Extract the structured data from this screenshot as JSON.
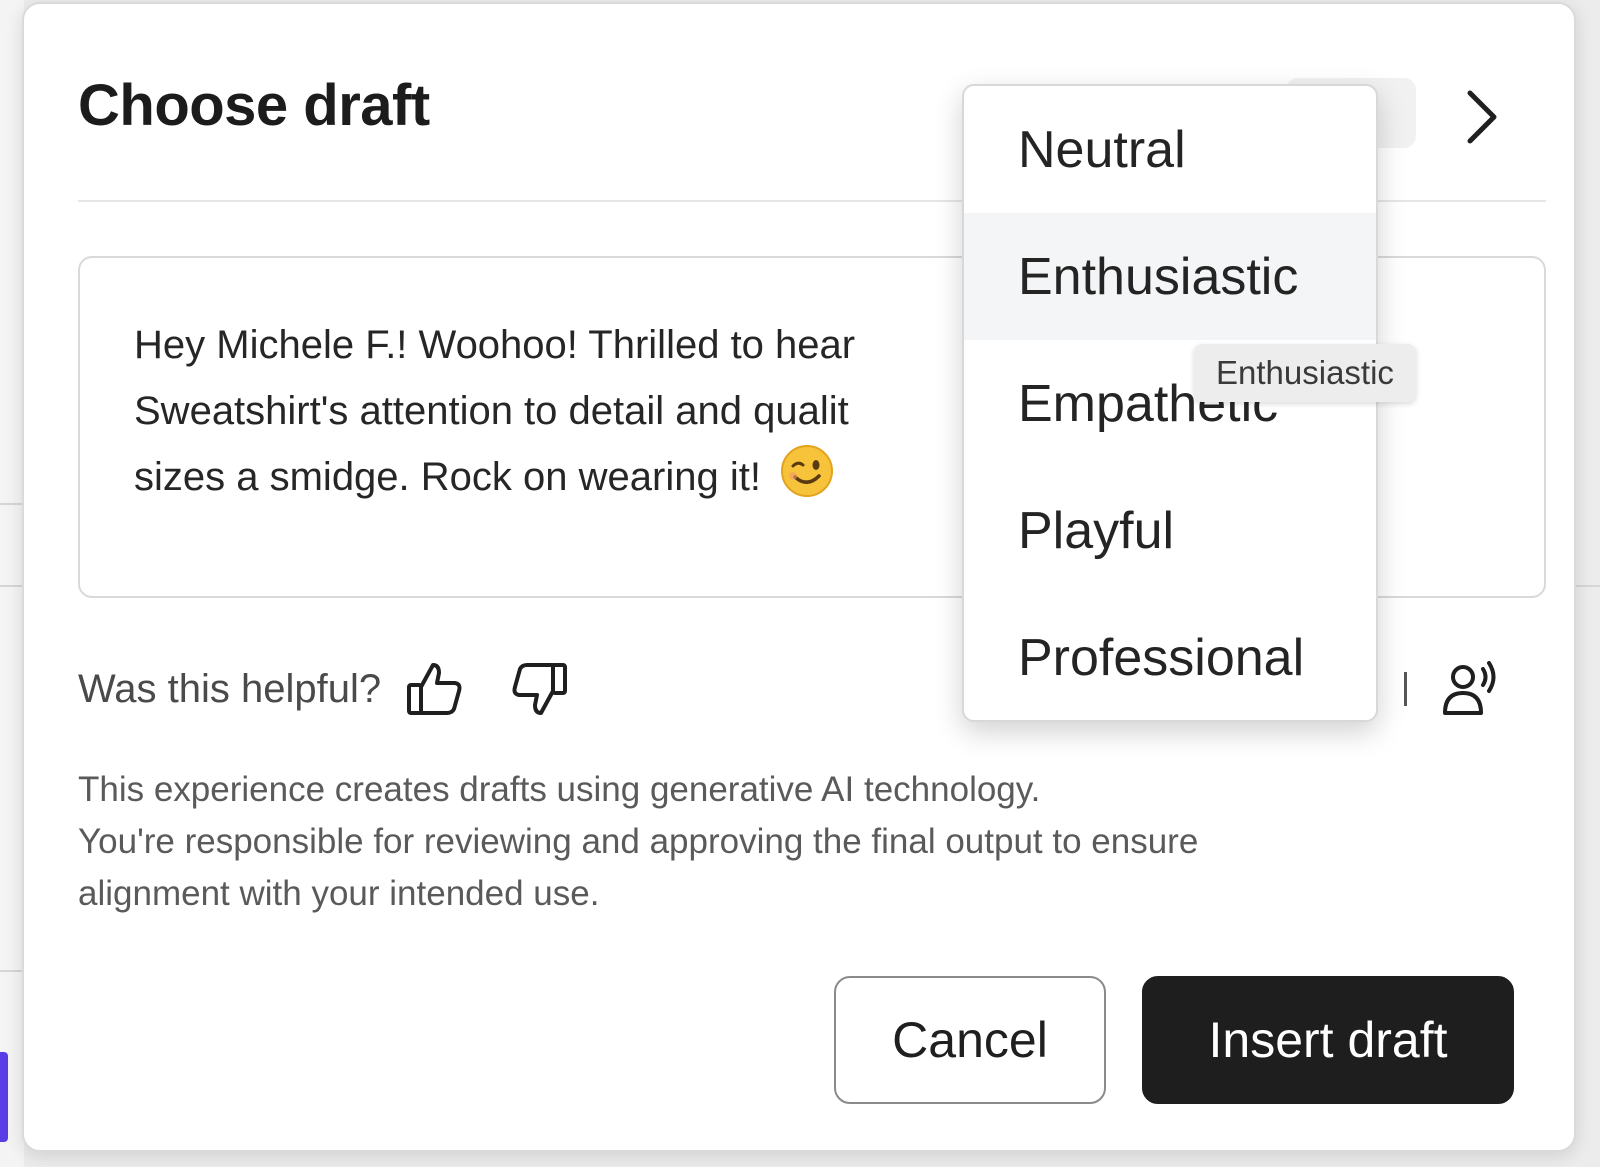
{
  "dialog": {
    "title": "Choose draft",
    "draft_text": "Hey Michele F.! Woohoo! Thrilled to hear",
    "draft_text_line2": "Sweatshirt's attention to detail and qualit",
    "draft_text_line3": "sizes a smidge. Rock on wearing it!",
    "feedback_label": "Was this helpful?",
    "disclaimer_line1": "This experience creates drafts using generative AI technology.",
    "disclaimer_line2": "You're responsible for reviewing and approving the final output to ensure",
    "disclaimer_line3": "alignment with your intended use.",
    "cancel_label": "Cancel",
    "insert_label": "Insert draft"
  },
  "tone_menu": {
    "items": [
      "Neutral",
      "Enthusiastic",
      "Empathetic",
      "Playful",
      "Professional"
    ],
    "hovered": "Enthusiastic",
    "tooltip": "Enthusiastic"
  },
  "icons": {
    "next": "chevron-right-icon",
    "thumbs_up": "thumbs-up-icon",
    "thumbs_down": "thumbs-down-icon",
    "voice": "voice-person-icon",
    "emoji": "winking-face-emoji"
  },
  "colors": {
    "primary_button": "#1e1e1e",
    "accent_left": "#5b3de6"
  }
}
